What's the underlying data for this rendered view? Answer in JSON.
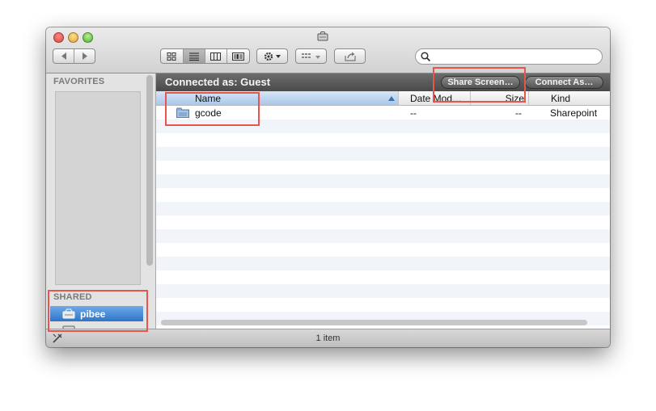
{
  "colors": {
    "annotation_red": "#e8554f",
    "selection_blue": "#3f84d4"
  },
  "toolbar": {
    "window_icon": "network-drive-icon",
    "back_icon": "chevron-left-icon",
    "forward_icon": "chevron-right-icon",
    "view_icons": [
      "icon-view-icon",
      "list-view-icon",
      "column-view-icon",
      "coverflow-view-icon"
    ],
    "action_icon": "gear-icon",
    "arrange_icon": "arrange-icon",
    "share_icon": "share-icon",
    "search_placeholder": ""
  },
  "sidebar": {
    "favorites_heading": "FAVORITES",
    "shared_heading": "SHARED",
    "shared_items": [
      {
        "label": "pibee",
        "icon": "network-drive-icon",
        "selected": true
      },
      {
        "label": "",
        "icon": "network-drive-icon",
        "selected": false
      }
    ]
  },
  "connection": {
    "status": "Connected as: Guest",
    "share_screen_label": "Share Screen…",
    "connect_as_label": "Connect As…"
  },
  "table": {
    "columns": [
      "Name",
      "Date Mod…",
      "Size",
      "Kind"
    ],
    "rows": [
      {
        "name": "gcode",
        "date": "--",
        "size": "--",
        "kind": "Sharepoint",
        "icon": "folder-icon"
      }
    ]
  },
  "status_bar": {
    "text": "1 item",
    "left_icon": "wrench-icon"
  }
}
